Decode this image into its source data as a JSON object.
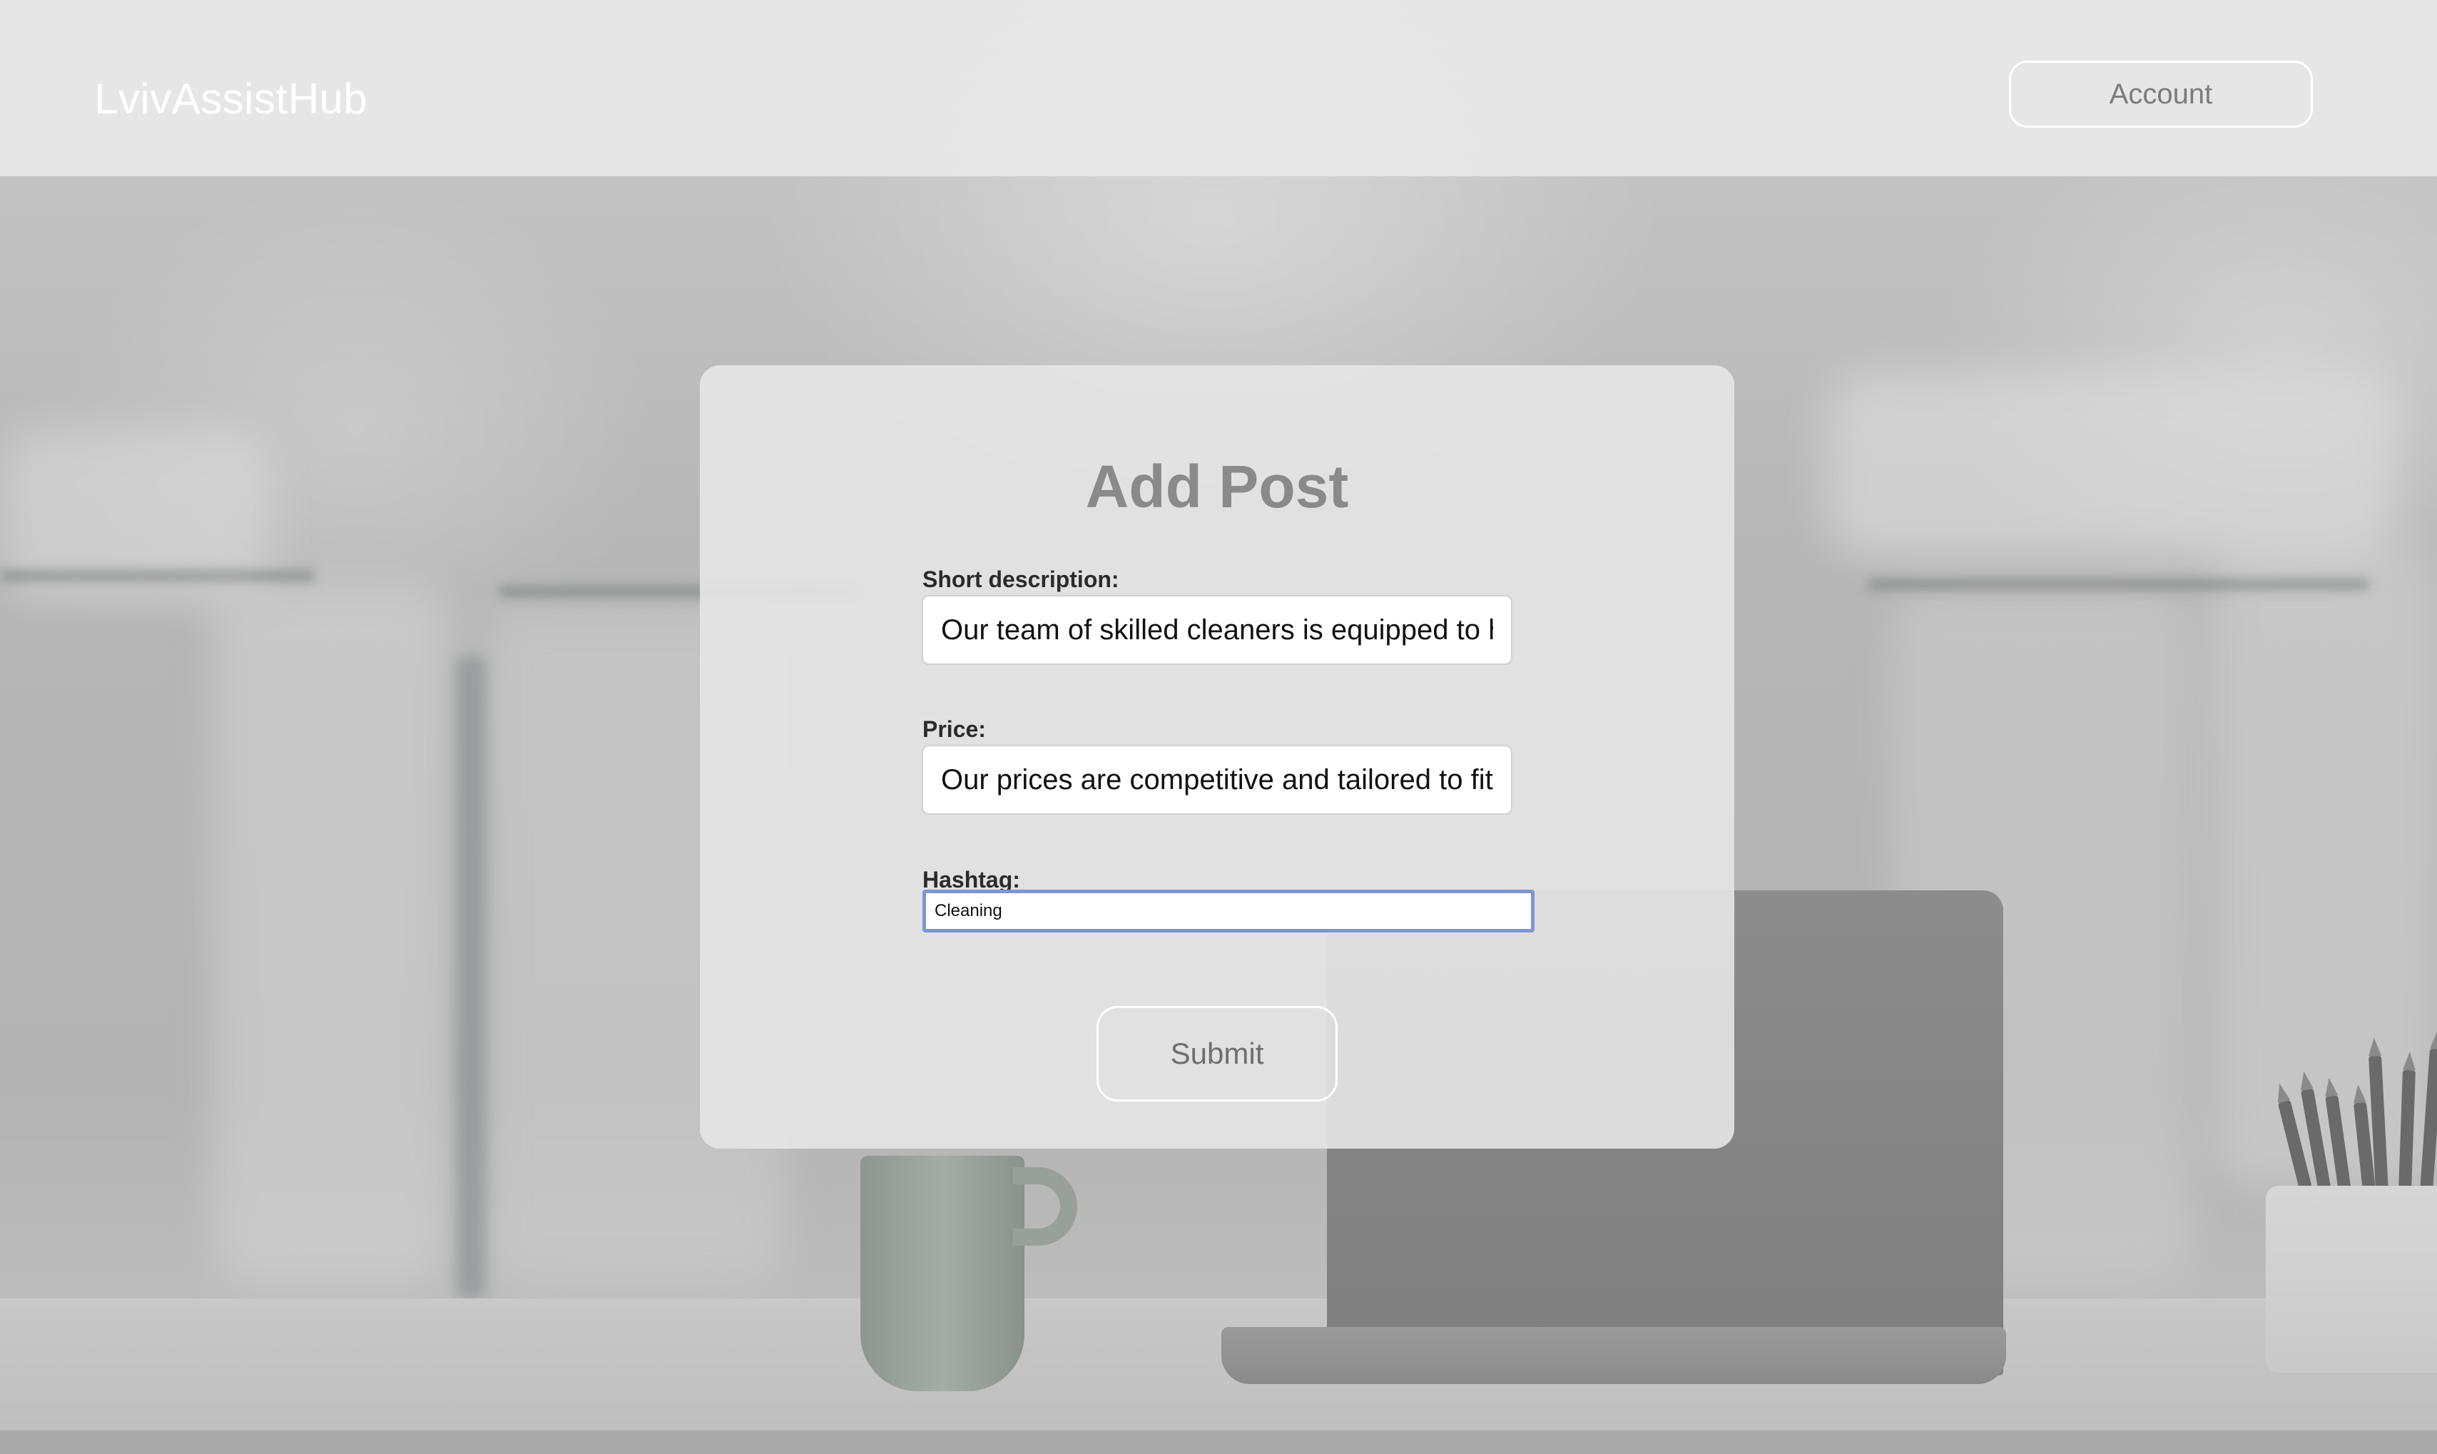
{
  "header": {
    "brand": "LvivAssistHub",
    "account_label": "Account"
  },
  "form": {
    "title": "Add Post",
    "short_description": {
      "label": "Short description:",
      "value": "Our team of skilled cleaners is equipped to handle"
    },
    "price": {
      "label": "Price:",
      "value": "Our prices are competitive and tailored to fit"
    },
    "hashtag": {
      "label": "Hashtag:",
      "value": "Cleaning"
    },
    "submit_label": "Submit"
  }
}
